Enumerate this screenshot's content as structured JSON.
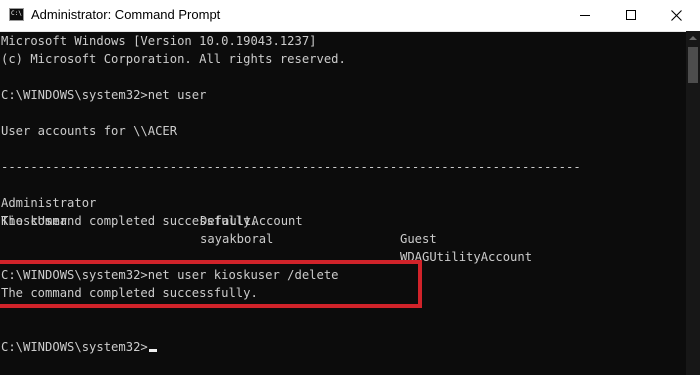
{
  "window": {
    "title": "Administrator: Command Prompt",
    "icon": "cmd-icon",
    "icon_glyph": "C:\\",
    "buttons": [
      "minimize-icon",
      "maximize-icon",
      "close-icon"
    ]
  },
  "console": {
    "header_line1": "Microsoft Windows [Version 10.0.19043.1237]",
    "header_line2": "(c) Microsoft Corporation. All rights reserved.",
    "cmd1": "C:\\WINDOWS\\system32>net user",
    "accounts_heading": "User accounts for \\\\ACER",
    "separator": "-------------------------------------------------------------------------------",
    "accounts_table": [
      [
        "Administrator",
        "DefaultAccount",
        "Guest"
      ],
      [
        "KioskUser",
        "sayakboral",
        "WDAGUtilityAccount"
      ]
    ],
    "completed1": "The command completed successfully.",
    "cmd2": "C:\\WINDOWS\\system32>net user kioskuser /delete",
    "completed2": "The command completed successfully.",
    "prompt": "C:\\WINDOWS\\system32>"
  },
  "colors": {
    "console_bg": "#0c0c0c",
    "console_text": "#cccccc",
    "highlight_border": "#d1232a",
    "titlebar_bg": "#ffffff"
  }
}
